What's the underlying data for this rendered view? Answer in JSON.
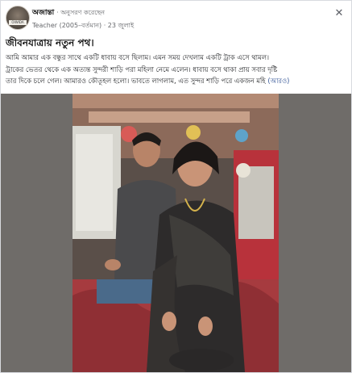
{
  "post": {
    "author": "অজান্তা",
    "follow_text": "· অনুসরণ করেছেন",
    "meta": "Teacher (2005–বর্তমান) · 23 জুলাই",
    "title": "জীবনযাত্রায় নতুন পথ।",
    "body_lines": [
      "আমি আমার এক বন্ধুর সাথে একটি ধাবায় বসে ছিলাম। এমন সময় দেখলাম একটি ট্রাক এসে থামল।",
      "ট্রাকের ভেতর থেকে এক অত্যন্ত সুন্দরী শাড়ি পরা মহিলা নেমে এলেন। ধাবায় বসে থাকা প্রায় সবার দৃষ্টি",
      "তার দিকে চলে গেল। আমারও কৌতূহল হলো। ভাবতে লাগলাম, এত সুন্দর শাড়ি পরে একজন মহি"
    ],
    "see_more": "(আরও)"
  },
  "avatar": {
    "label": "OIWIDA"
  },
  "icons": {
    "close": "close-icon"
  },
  "colors": {
    "link": "#385898",
    "meta": "#65676b",
    "media_bg": "#6f6c69"
  }
}
